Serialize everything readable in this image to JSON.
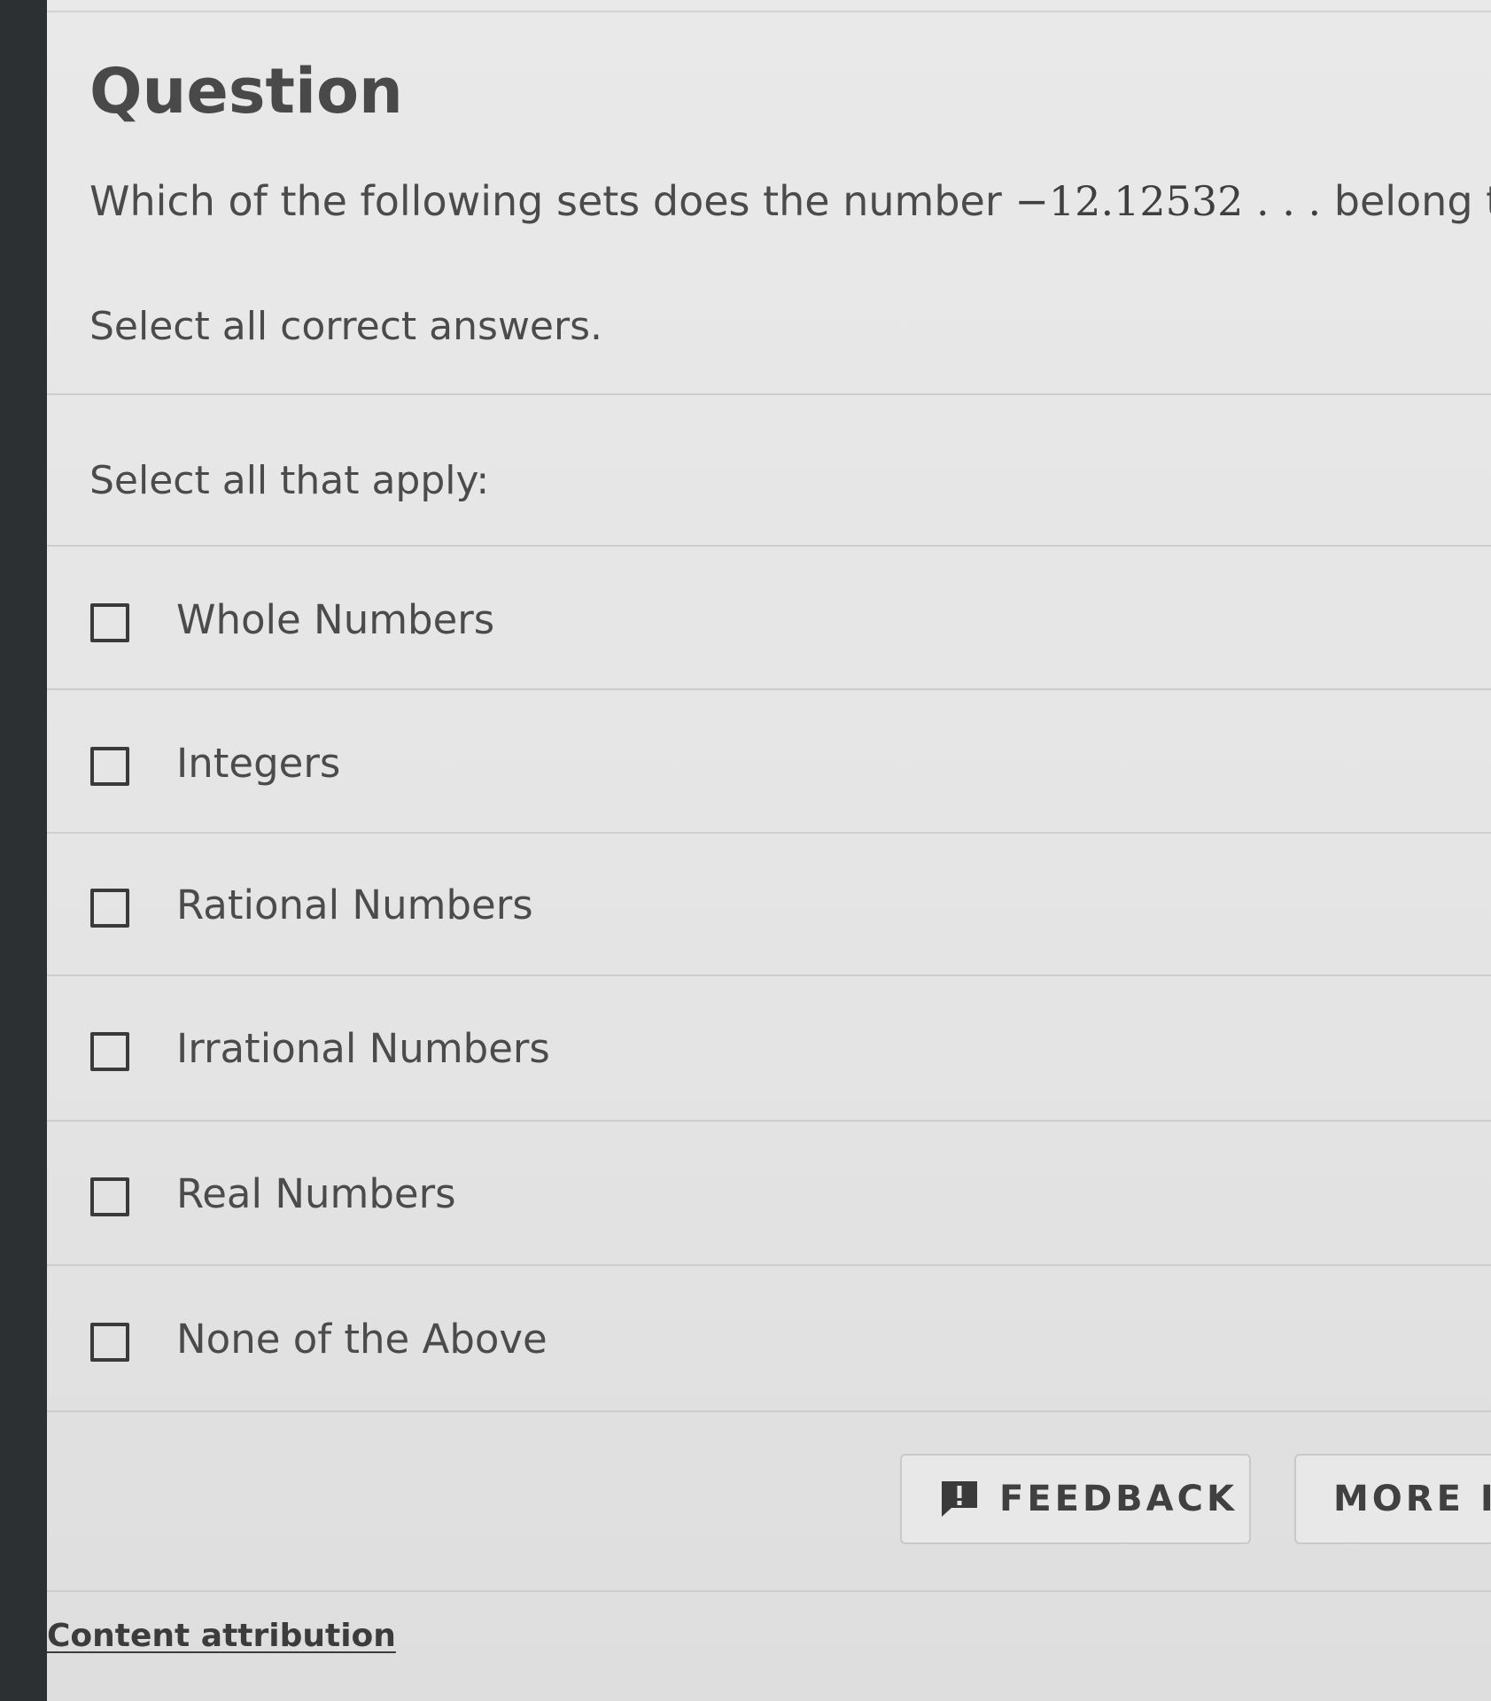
{
  "question": {
    "title": "Question",
    "prompt_before": "Which of the following sets does the number ",
    "number": "−12.12532 . . .",
    "prompt_after": " belong to?",
    "instruction": "Select all correct answers."
  },
  "answers": {
    "label": "Select all that apply:",
    "options": [
      {
        "label": "Whole Numbers",
        "checked": false
      },
      {
        "label": "Integers",
        "checked": false
      },
      {
        "label": "Rational Numbers",
        "checked": false
      },
      {
        "label": "Irrational Numbers",
        "checked": false
      },
      {
        "label": "Real Numbers",
        "checked": false
      },
      {
        "label": "None of the Above",
        "checked": false
      }
    ]
  },
  "footer": {
    "feedback_label": "FEEDBACK",
    "feedback_icon": "feedback-icon",
    "more_label": "MORE IN",
    "attribution": "Content attribution"
  },
  "colors": {
    "sidebar": "#2d3033",
    "background": "#e6e6e6",
    "text": "#4b4b4b",
    "divider": "#cdcdcd"
  }
}
